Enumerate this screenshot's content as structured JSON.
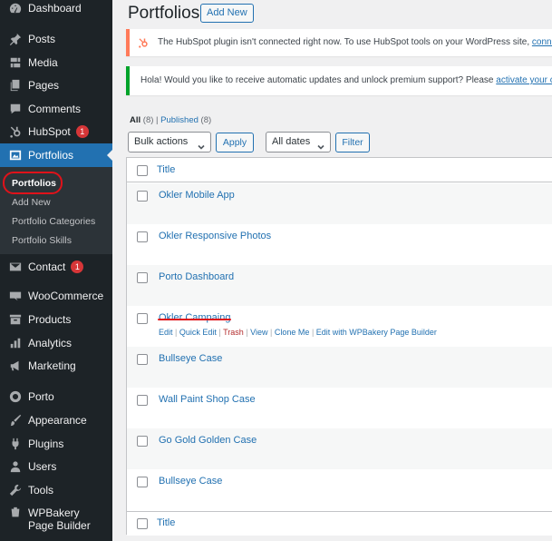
{
  "sidebar": {
    "items": [
      {
        "label": "Dashboard",
        "icon": "dashboard-icon"
      },
      {
        "label": "Posts",
        "icon": "pin-icon"
      },
      {
        "label": "Media",
        "icon": "media-icon"
      },
      {
        "label": "Pages",
        "icon": "pages-icon"
      },
      {
        "label": "Comments",
        "icon": "comment-icon"
      },
      {
        "label": "HubSpot",
        "icon": "hubspot-icon",
        "badge": "1"
      },
      {
        "label": "Portfolios",
        "icon": "portfolio-icon",
        "active": true
      },
      {
        "label": "Contact",
        "icon": "mail-icon",
        "badge": "1"
      },
      {
        "label": "WooCommerce",
        "icon": "woo-icon"
      },
      {
        "label": "Products",
        "icon": "archive-icon"
      },
      {
        "label": "Analytics",
        "icon": "chart-bar-icon"
      },
      {
        "label": "Marketing",
        "icon": "megaphone-icon"
      },
      {
        "label": "Porto",
        "icon": "porto-icon"
      },
      {
        "label": "Appearance",
        "icon": "brush-icon"
      },
      {
        "label": "Plugins",
        "icon": "plug-icon"
      },
      {
        "label": "Users",
        "icon": "users-icon"
      },
      {
        "label": "Tools",
        "icon": "wrench-icon"
      },
      {
        "label": "WPBakery Page Builder",
        "icon": "wpbakery-icon"
      }
    ],
    "submenu": [
      "Portfolios",
      "Add New",
      "Portfolio Categories",
      "Portfolio Skills"
    ]
  },
  "header": {
    "title": "Portfolios",
    "add_new": "Add New"
  },
  "notices": {
    "hubspot": "The HubSpot plugin isn't connected right now. To use HubSpot tools on your WordPress site,",
    "hubspot_link": "connect",
    "update": "Hola! Would you like to receive automatic updates and unlock premium support? Please",
    "update_link": "activate your cop"
  },
  "filters": {
    "all": "All",
    "all_count": "(8)",
    "separator": "|",
    "published": "Published",
    "published_count": "(8)",
    "bulk_actions": "Bulk actions",
    "apply": "Apply",
    "all_dates": "All dates",
    "filter": "Filter"
  },
  "table": {
    "column_title": "Title",
    "rows": [
      "Okler Mobile App",
      "Okler Responsive Photos",
      "Porto Dashboard",
      "Okler Campaing",
      "Bullseye Case",
      "Wall Paint Shop Case",
      "Go Gold Golden Case",
      "Bullseye Case"
    ],
    "row_actions": {
      "edit": "Edit",
      "quick_edit": "Quick Edit",
      "trash": "Trash",
      "view": "View",
      "clone": "Clone Me",
      "wpbakery": "Edit with WPBakery Page Builder",
      "sep": "|"
    }
  },
  "colors": {
    "sidebar_bg": "#1d2327",
    "active": "#2271b1",
    "link": "#2271b1",
    "annotation": "#e0121a",
    "hubspot": "#ff7a59",
    "notice_success": "#00a32a"
  }
}
